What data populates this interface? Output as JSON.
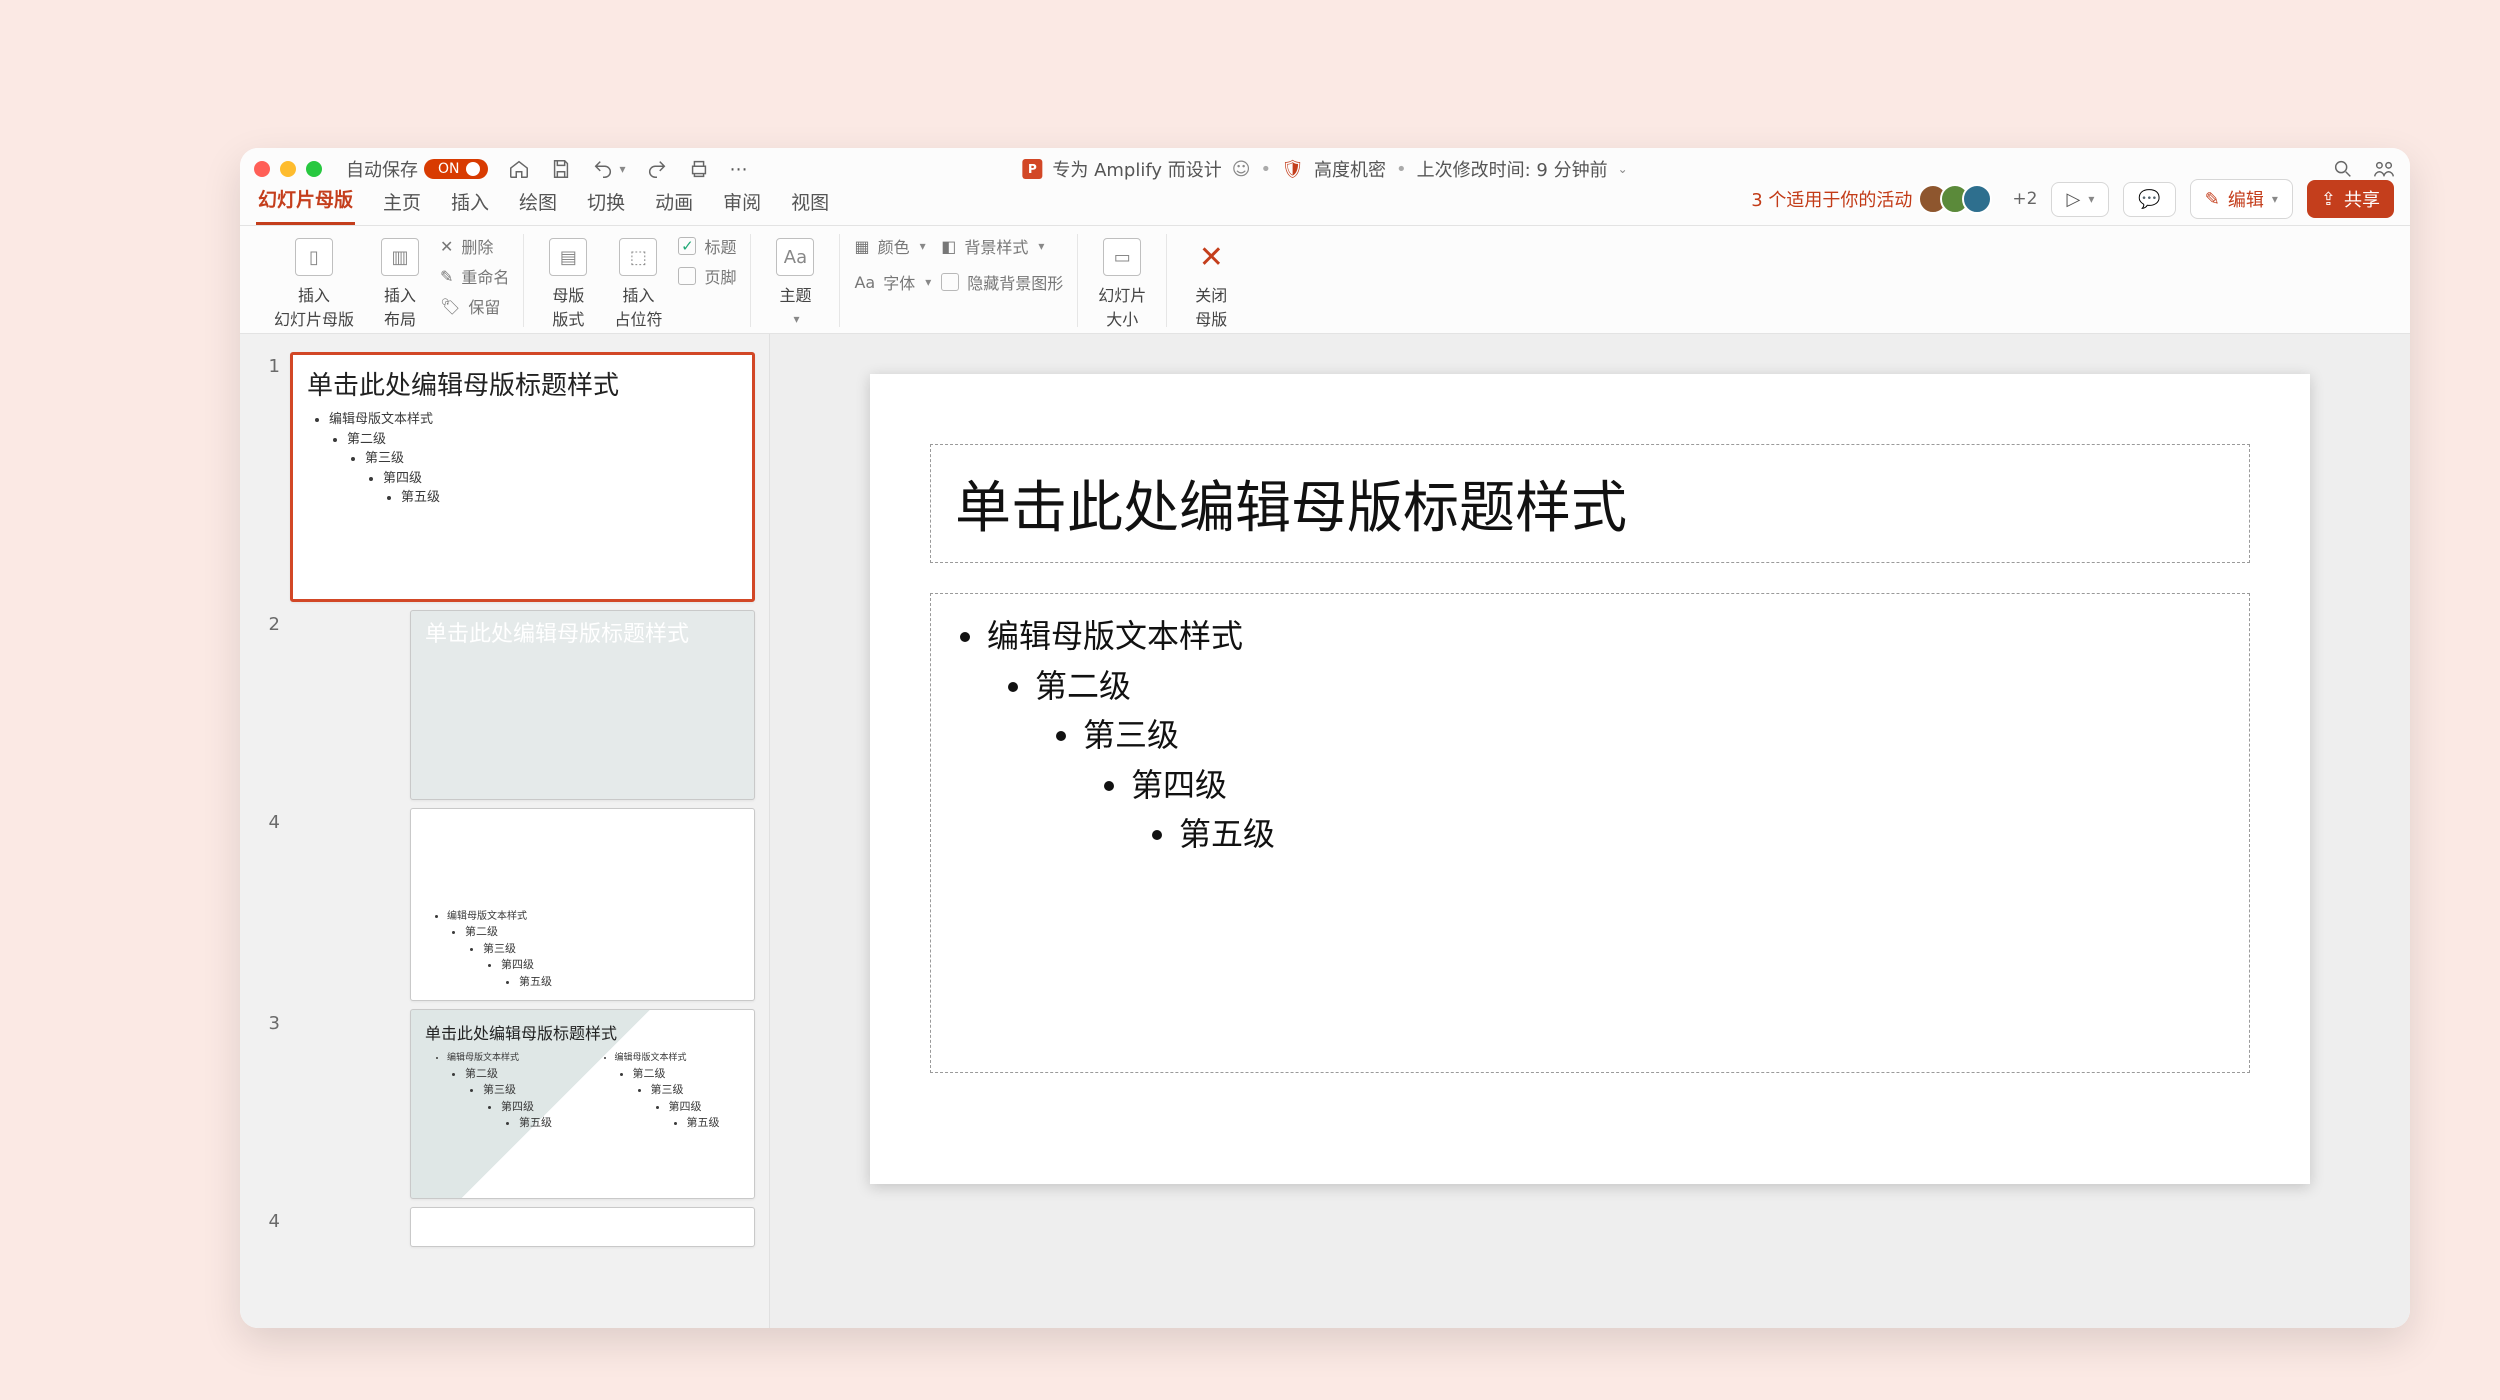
{
  "titlebar": {
    "autosave_label": "自动保存",
    "autosave_state": "ON",
    "doc_title": "专为 Amplify 而设计",
    "sensitivity": "高度机密",
    "last_modified": "上次修改时间: 9 分钟前"
  },
  "tabs": {
    "slide_master": "幻灯片母版",
    "home": "主页",
    "insert": "插入",
    "draw": "绘图",
    "transitions": "切换",
    "animations": "动画",
    "review": "审阅",
    "view": "视图"
  },
  "tabright": {
    "activity": "3 个适用于你的活动",
    "plus2": "+2",
    "edit": "编辑",
    "share": "共享"
  },
  "ribbon": {
    "insert_master": "插入\n幻灯片母版",
    "insert_layout": "插入\n布局",
    "delete": "删除",
    "rename": "重命名",
    "preserve": "保留",
    "master_layout": "母版\n版式",
    "insert_placeholder": "插入\n占位符",
    "title_chk": "标题",
    "footer_chk": "页脚",
    "themes": "主题",
    "colors": "颜色",
    "fonts": "字体",
    "bg_styles": "背景样式",
    "hide_bg": "隐藏背景图形",
    "slide_size": "幻灯片\n大小",
    "close_master": "关闭\n母版"
  },
  "thumbs": {
    "n1": "1",
    "n2": "2",
    "n3": "3",
    "n4a": "4",
    "n4b": "4",
    "master_title": "单击此处编辑母版标题样式",
    "layout_title_2line": "单击此处编辑母版标题样式",
    "small_title": "单击此处编辑母版标题样式",
    "body_l1": "编辑母版文本样式",
    "body_l2": "第二级",
    "body_l3": "第三级",
    "body_l4": "第四级",
    "body_l5": "第五级"
  },
  "slide": {
    "title": "单击此处编辑母版标题样式",
    "l1": "编辑母版文本样式",
    "l2": "第二级",
    "l3": "第三级",
    "l4": "第四级",
    "l5": "第五级"
  }
}
